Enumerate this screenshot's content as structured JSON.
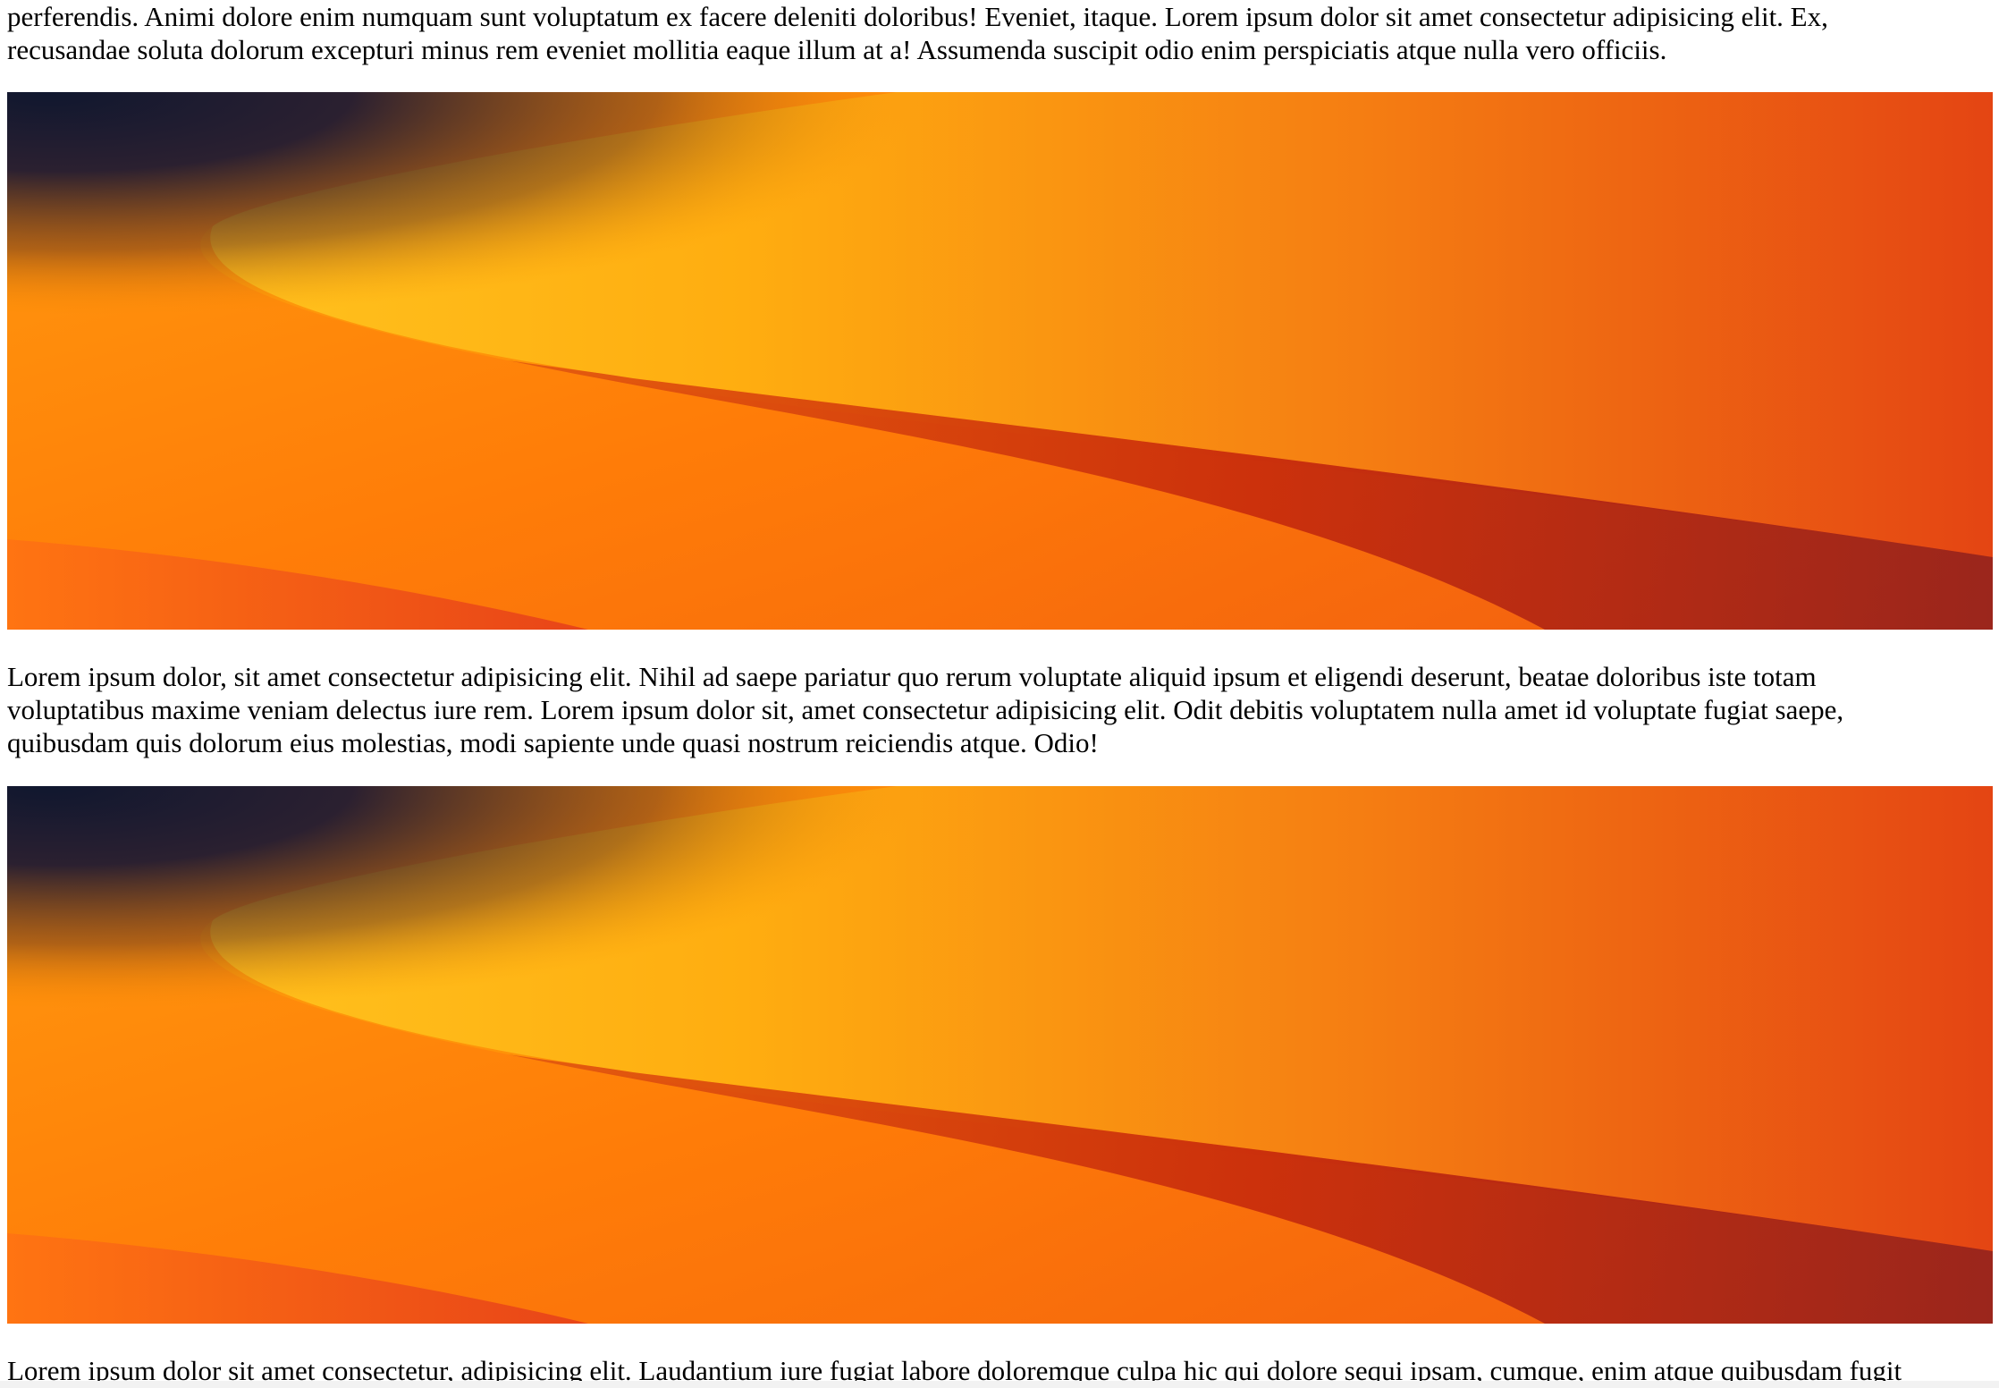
{
  "paragraphs": [
    {
      "lines": [
        "perferendis. Animi dolore enim numquam sunt voluptatum ex facere deleniti doloribus! Eveniet, itaque. Lorem ipsum dolor sit amet consectetur adipisicing elit. Ex,",
        "recusandae soluta dolorum excepturi minus rem eveniet mollitia eaque illum at a! Assumenda suscipit odio enim perspiciatis atque nulla vero officiis."
      ]
    },
    {
      "lines": [
        "Lorem ipsum dolor, sit amet consectetur adipisicing elit. Nihil ad saepe pariatur quo rerum voluptate aliquid ipsum et eligendi deserunt, beatae doloribus iste totam",
        "voluptatibus maxime veniam delectus iure rem. Lorem ipsum dolor sit, amet consectetur adipisicing elit. Odit debitis voluptatem nulla amet id voluptate fugiat saepe,",
        "quibusdam quis dolorum eius molestias, modi sapiente unde quasi nostrum reiciendis atque. Odio!"
      ]
    },
    {
      "lines": [
        "Lorem ipsum dolor sit amet consectetur, adipisicing elit. Laudantium iure fugiat labore doloremque culpa hic qui dolore sequi ipsam, cumque, enim atque quibusdam fugit"
      ]
    }
  ],
  "banner_colors": {
    "dark": "#141a33",
    "yellow": "#ffb21a",
    "orange": "#ff8a00",
    "red": "#c8240c",
    "deep_red": "#8e1c1c"
  }
}
